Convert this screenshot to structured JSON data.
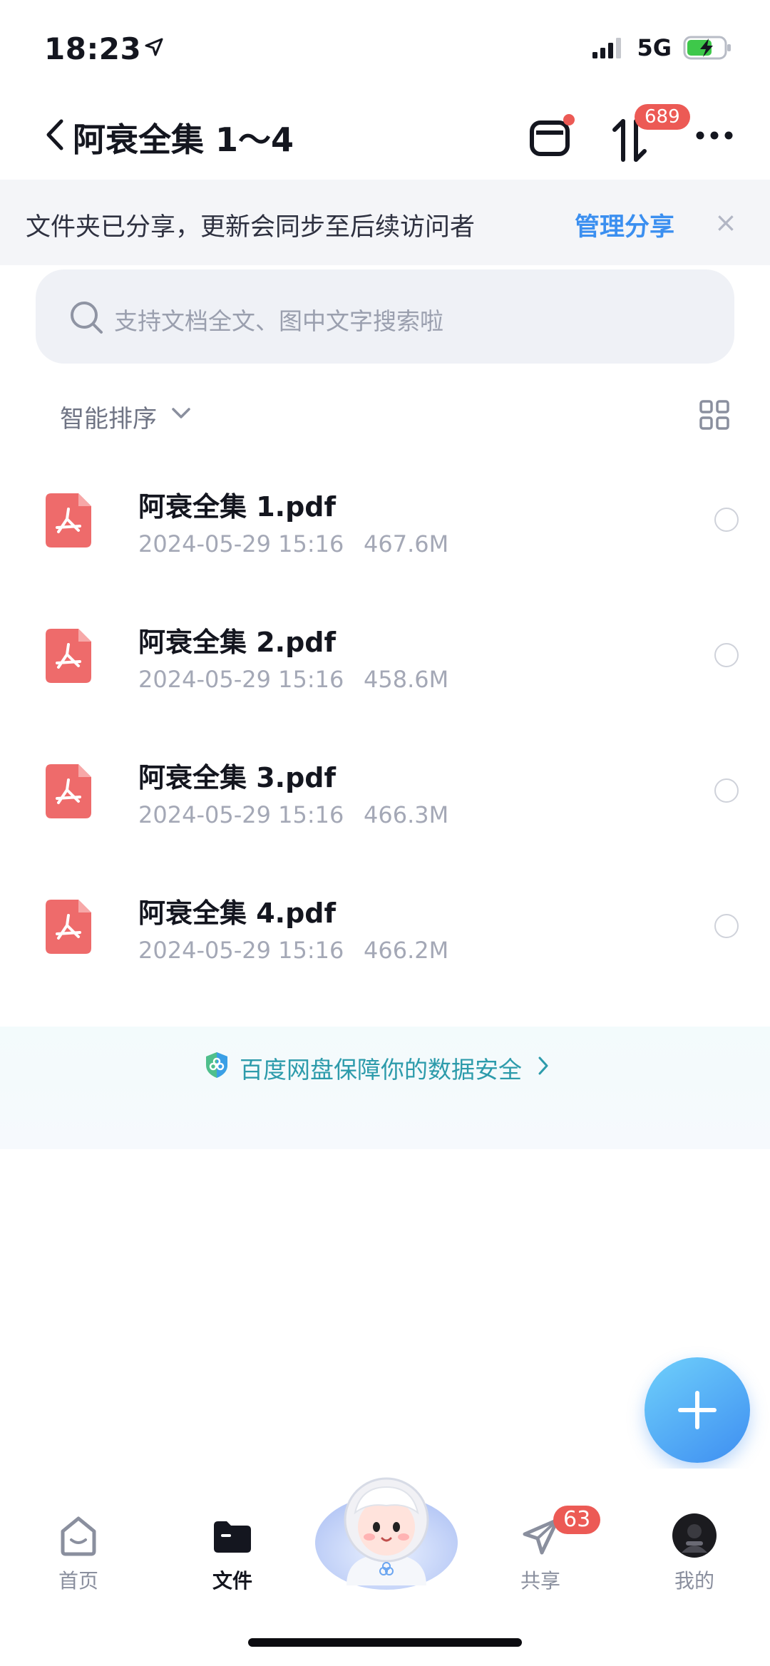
{
  "status_bar": {
    "time": "18:23",
    "network": "5G"
  },
  "header": {
    "title": "阿衰全集 1～4",
    "transfer_badge": "689"
  },
  "share_banner": {
    "text": "文件夹已分享，更新会同步至后续访问者",
    "manage_label": "管理分享",
    "close_label": "×"
  },
  "search": {
    "placeholder": "支持文档全文、图中文字搜索啦"
  },
  "sort": {
    "label": "智能排序"
  },
  "files": [
    {
      "name": "阿衰全集 1.pdf",
      "date": "2024-05-29 15:16",
      "size": "467.6M"
    },
    {
      "name": "阿衰全集 2.pdf",
      "date": "2024-05-29 15:16",
      "size": "458.6M"
    },
    {
      "name": "阿衰全集 3.pdf",
      "date": "2024-05-29 15:16",
      "size": "466.3M"
    },
    {
      "name": "阿衰全集 4.pdf",
      "date": "2024-05-29 15:16",
      "size": "466.2M"
    }
  ],
  "security_banner": {
    "text": "百度网盘保障你的数据安全"
  },
  "tab_bar": {
    "items": [
      {
        "label": "首页",
        "icon": "home-icon"
      },
      {
        "label": "文件",
        "icon": "folder-icon"
      },
      {
        "label": "",
        "icon": "assistant-mascot"
      },
      {
        "label": "共享",
        "icon": "send-icon",
        "badge": "63"
      },
      {
        "label": "我的",
        "icon": "avatar"
      }
    ]
  },
  "colors": {
    "accent": "#3b8ff0",
    "badge": "#ec5a55",
    "pdf": "#ee6b6b"
  }
}
